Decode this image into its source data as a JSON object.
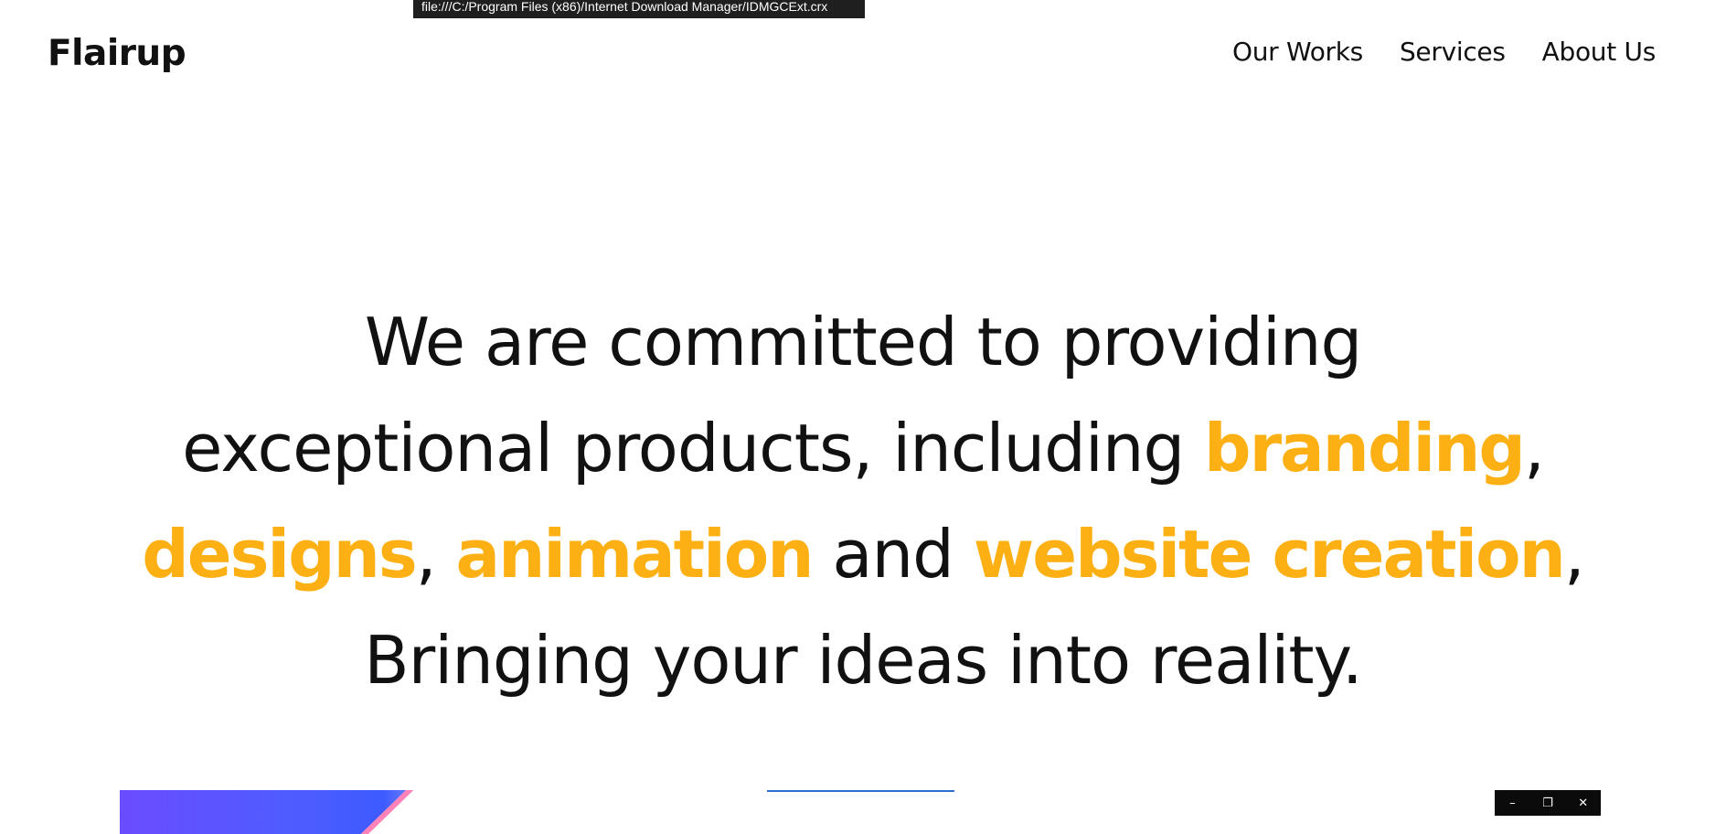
{
  "status_tooltip": "file:///C:/Program Files (x86)/Internet Download Manager/IDMGCExt.crx",
  "header": {
    "logo": "Flairup",
    "nav": [
      {
        "label": "Our Works"
      },
      {
        "label": "Services"
      },
      {
        "label": "About Us"
      }
    ]
  },
  "hero": {
    "line1": "We are committed to providing",
    "line2_text": "exceptional products, including ",
    "hl_branding": "branding",
    "comma": ",",
    "hl_designs": "designs",
    "comma_space": ", ",
    "hl_animation": "animation",
    "and_text": " and ",
    "hl_website": "website creation",
    "line4": "Bringing your ideas into reality."
  },
  "mini_controls": {
    "minimize": "–",
    "restore": "❐",
    "close": "✕"
  },
  "colors": {
    "accent": "#fdb014",
    "text": "#111111",
    "background": "#ffffff"
  }
}
